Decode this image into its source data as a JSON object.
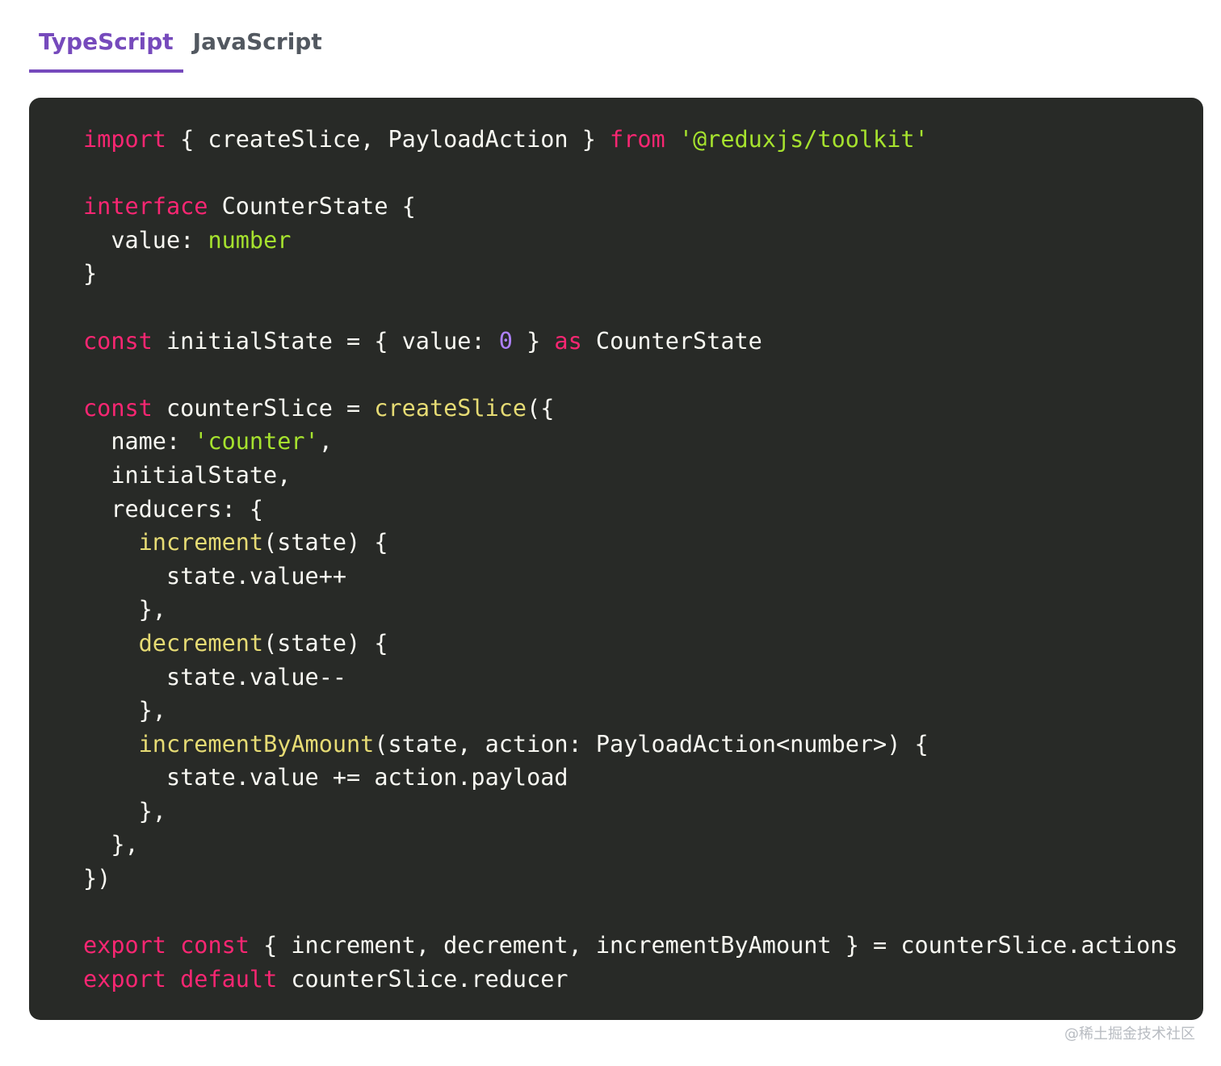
{
  "tabs": [
    {
      "label": "TypeScript",
      "active": true
    },
    {
      "label": "JavaScript",
      "active": false
    }
  ],
  "colors": {
    "accent": "#764abc",
    "inactive_tab": "#525860",
    "code_background": "#282a27",
    "keyword": "#f92672",
    "string": "#a6e22e",
    "function": "#e6db74",
    "number": "#ae81ff",
    "text": "#f8f8f2"
  },
  "code_lines": [
    [
      {
        "t": "keyword",
        "v": "import"
      },
      {
        "t": "plain",
        "v": " { createSlice, PayloadAction } "
      },
      {
        "t": "keyword",
        "v": "from"
      },
      {
        "t": "plain",
        "v": " "
      },
      {
        "t": "string",
        "v": "'@reduxjs/toolkit'"
      }
    ],
    [],
    [
      {
        "t": "keyword",
        "v": "interface"
      },
      {
        "t": "plain",
        "v": " CounterState {"
      }
    ],
    [
      {
        "t": "plain",
        "v": "  value: "
      },
      {
        "t": "type",
        "v": "number"
      }
    ],
    [
      {
        "t": "plain",
        "v": "}"
      }
    ],
    [],
    [
      {
        "t": "keyword",
        "v": "const"
      },
      {
        "t": "plain",
        "v": " initialState = { value: "
      },
      {
        "t": "number",
        "v": "0"
      },
      {
        "t": "plain",
        "v": " } "
      },
      {
        "t": "keyword",
        "v": "as"
      },
      {
        "t": "plain",
        "v": " CounterState"
      }
    ],
    [],
    [
      {
        "t": "keyword",
        "v": "const"
      },
      {
        "t": "plain",
        "v": " counterSlice = "
      },
      {
        "t": "func",
        "v": "createSlice"
      },
      {
        "t": "plain",
        "v": "({"
      }
    ],
    [
      {
        "t": "plain",
        "v": "  name: "
      },
      {
        "t": "string",
        "v": "'counter'"
      },
      {
        "t": "plain",
        "v": ","
      }
    ],
    [
      {
        "t": "plain",
        "v": "  initialState,"
      }
    ],
    [
      {
        "t": "plain",
        "v": "  reducers: {"
      }
    ],
    [
      {
        "t": "plain",
        "v": "    "
      },
      {
        "t": "func",
        "v": "increment"
      },
      {
        "t": "plain",
        "v": "(state) {"
      }
    ],
    [
      {
        "t": "plain",
        "v": "      state.value++"
      }
    ],
    [
      {
        "t": "plain",
        "v": "    },"
      }
    ],
    [
      {
        "t": "plain",
        "v": "    "
      },
      {
        "t": "func",
        "v": "decrement"
      },
      {
        "t": "plain",
        "v": "(state) {"
      }
    ],
    [
      {
        "t": "plain",
        "v": "      state.value--"
      }
    ],
    [
      {
        "t": "plain",
        "v": "    },"
      }
    ],
    [
      {
        "t": "plain",
        "v": "    "
      },
      {
        "t": "func",
        "v": "incrementByAmount"
      },
      {
        "t": "plain",
        "v": "(state, action: PayloadAction<number>) {"
      }
    ],
    [
      {
        "t": "plain",
        "v": "      state.value += action.payload"
      }
    ],
    [
      {
        "t": "plain",
        "v": "    },"
      }
    ],
    [
      {
        "t": "plain",
        "v": "  },"
      }
    ],
    [
      {
        "t": "plain",
        "v": "})"
      }
    ],
    [],
    [
      {
        "t": "keyword",
        "v": "export"
      },
      {
        "t": "plain",
        "v": " "
      },
      {
        "t": "keyword",
        "v": "const"
      },
      {
        "t": "plain",
        "v": " { increment, decrement, incrementByAmount } = counterSlice.actions"
      }
    ],
    [
      {
        "t": "keyword",
        "v": "export"
      },
      {
        "t": "plain",
        "v": " "
      },
      {
        "t": "keyword",
        "v": "default"
      },
      {
        "t": "plain",
        "v": " counterSlice.reducer"
      }
    ]
  ],
  "watermark": "@稀土掘金技术社区"
}
